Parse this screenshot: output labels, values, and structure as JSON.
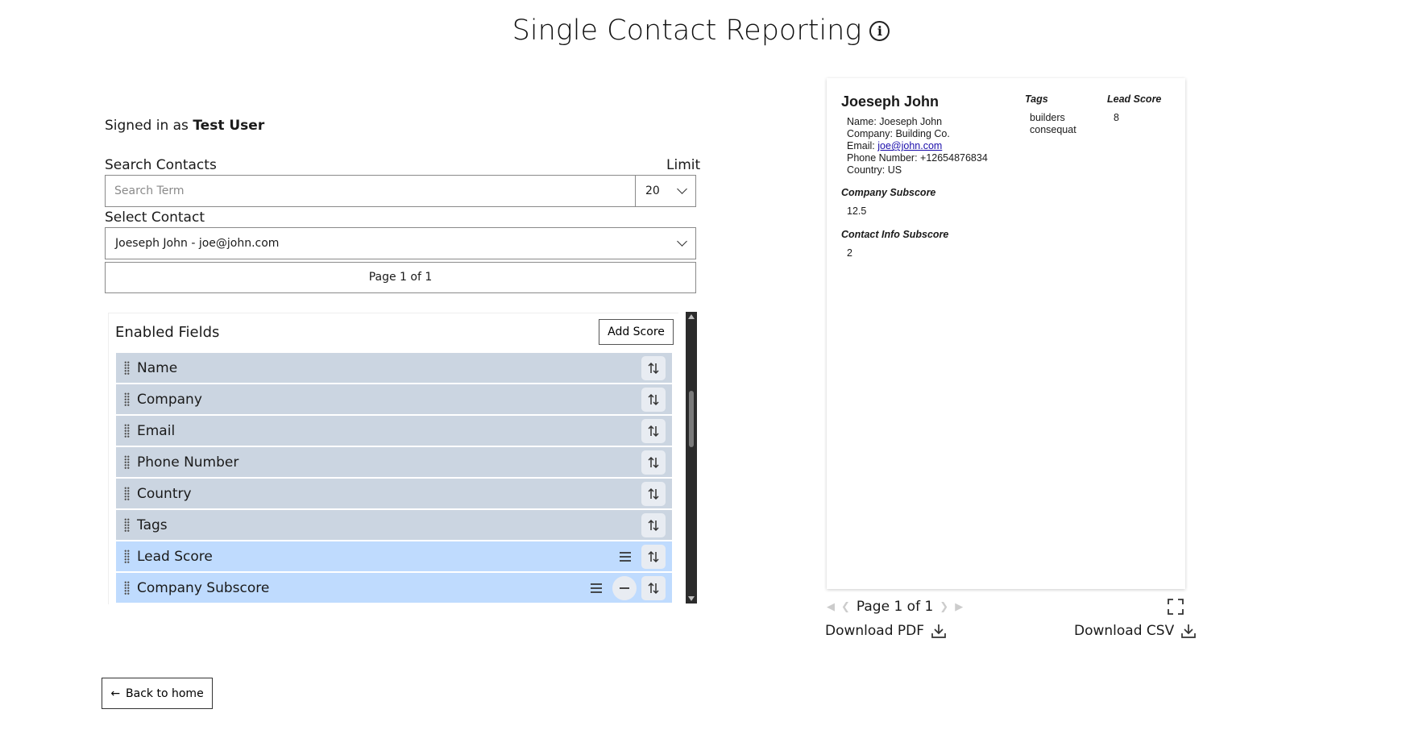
{
  "page": {
    "title": "Single Contact Reporting",
    "info_icon": "info-circle-icon",
    "signed_in_prefix": "Signed in as",
    "signed_in_user": "Test User"
  },
  "search": {
    "label": "Search Contacts",
    "placeholder": "Search Term",
    "value": "",
    "limit_label": "Limit",
    "limit_value": "20"
  },
  "contact": {
    "label": "Select Contact",
    "selected": "Joeseph John - joe@john.com",
    "pager": "Page 1 of 1"
  },
  "fields": {
    "title": "Enabled Fields",
    "add_score": "Add Score",
    "items": [
      {
        "label": "Name",
        "type": "field"
      },
      {
        "label": "Company",
        "type": "field"
      },
      {
        "label": "Email",
        "type": "field"
      },
      {
        "label": "Phone Number",
        "type": "field"
      },
      {
        "label": "Country",
        "type": "field"
      },
      {
        "label": "Tags",
        "type": "field"
      },
      {
        "label": "Lead Score",
        "type": "score"
      },
      {
        "label": "Company Subscore",
        "type": "subscore"
      }
    ],
    "colors": {
      "field": "#cbd5e1",
      "score": "#bfdbfe"
    }
  },
  "nav": {
    "back_label": "Back to home",
    "back_icon": "arrow-left-icon"
  },
  "report": {
    "contact_name": "Joeseph John",
    "name_line": "Name: Joeseph John",
    "company_line": "Company: Building Co.",
    "email_prefix": "Email:",
    "email": "joe@john.com",
    "phone_line": "Phone Number: +12654876834",
    "country_line": "Country: US",
    "tags_heading": "Tags",
    "tags": [
      "builders",
      "consequat"
    ],
    "lead_score_heading": "Lead Score",
    "lead_score": "8",
    "company_subscore_heading": "Company Subscore",
    "company_subscore": "12.5",
    "contact_info_subscore_heading": "Contact Info Subscore",
    "contact_info_subscore": "2"
  },
  "viewer": {
    "page_label": "Page 1 of 1",
    "download_pdf": "Download PDF",
    "download_csv": "Download CSV",
    "download_icon": "download-icon",
    "fullscreen_icon": "fullscreen-icon"
  }
}
